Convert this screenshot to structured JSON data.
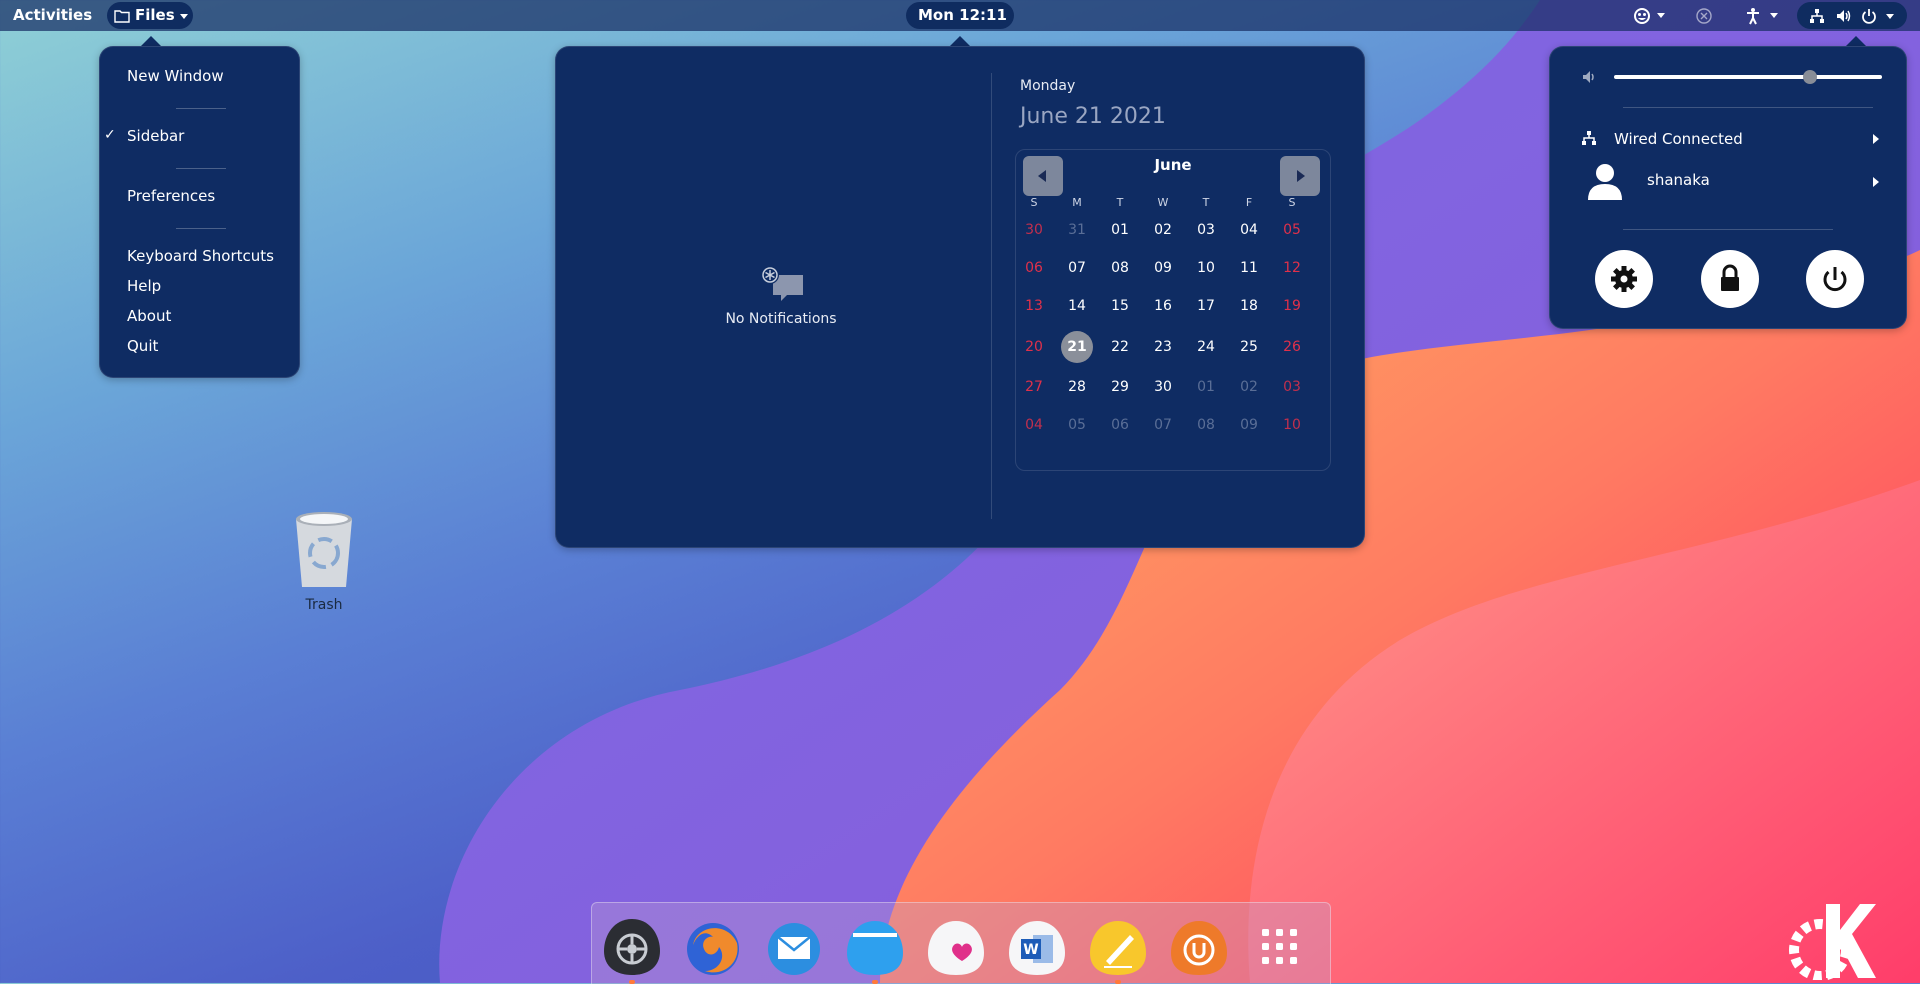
{
  "topbar": {
    "activities": "Activities",
    "app_menu_label": "Files",
    "clock": "Mon 12:11"
  },
  "files_menu": {
    "items": [
      {
        "label": "New Window"
      },
      {
        "label": "Sidebar",
        "checked": true,
        "check_mark": "✓"
      },
      {
        "label": "Preferences"
      },
      {
        "label": "Keyboard Shortcuts"
      },
      {
        "label": "Help"
      },
      {
        "label": "About"
      },
      {
        "label": "Quit"
      }
    ]
  },
  "notifications": {
    "empty_text": "No Notifications"
  },
  "calendar": {
    "weekday": "Monday",
    "full_date": "June 21 2021",
    "month": "June",
    "day_headers": [
      "S",
      "M",
      "T",
      "W",
      "T",
      "F",
      "S"
    ],
    "weeks": [
      [
        "30",
        "31",
        "01",
        "02",
        "03",
        "04",
        "05"
      ],
      [
        "06",
        "07",
        "08",
        "09",
        "10",
        "11",
        "12"
      ],
      [
        "13",
        "14",
        "15",
        "16",
        "17",
        "18",
        "19"
      ],
      [
        "20",
        "21",
        "22",
        "23",
        "24",
        "25",
        "26"
      ],
      [
        "27",
        "28",
        "29",
        "30",
        "01",
        "02",
        "03"
      ],
      [
        "04",
        "05",
        "06",
        "07",
        "08",
        "09",
        "10"
      ]
    ],
    "today": "21",
    "colors": {
      "weekend": "#e0304a",
      "other_month": "#5a6e96",
      "today_bg": "#8a8f9a"
    }
  },
  "system_menu": {
    "volume_level": 0.73,
    "network_label": "Wired Connected",
    "user_label": "shanaka"
  },
  "desktop": {
    "trash_label": "Trash"
  },
  "dock": {
    "apps": [
      "system-settings-icon",
      "firefox-icon",
      "mail-icon",
      "files-icon",
      "heart-app-icon",
      "word-icon",
      "notes-icon",
      "backup-icon",
      "app-grid-icon"
    ]
  },
  "colors": {
    "panel": "#0f2c63",
    "accent_orange": "#ff8a3c",
    "accent_pink": "#ff3a6a"
  }
}
